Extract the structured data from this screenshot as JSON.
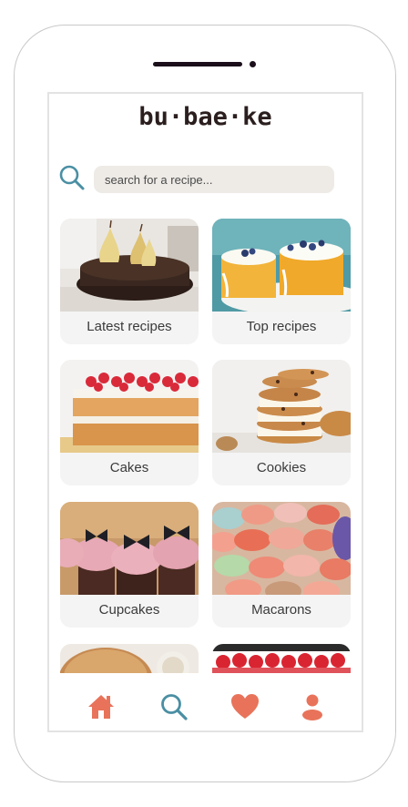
{
  "app": {
    "logo_text": "bu·bae·ke"
  },
  "search": {
    "placeholder": "search for a recipe..."
  },
  "categories": [
    {
      "label": "Latest recipes",
      "image": "chocolate-cake-with-pears"
    },
    {
      "label": "Top recipes",
      "image": "blueberry-cheesecakes"
    },
    {
      "label": "Cakes",
      "image": "raspberry-sponge-cake"
    },
    {
      "label": "Cookies",
      "image": "stacked-cookies"
    },
    {
      "label": "Cupcakes",
      "image": "bow-topped-cupcakes"
    },
    {
      "label": "Macarons",
      "image": "colorful-macarons"
    },
    {
      "label": "",
      "image": "pie-and-drink"
    },
    {
      "label": "",
      "image": "strawberry-tart"
    }
  ],
  "nav": {
    "items": [
      "home-icon",
      "search-icon",
      "heart-icon",
      "user-icon"
    ],
    "active_color": "#e8735a",
    "accent_color": "#4a8fa3"
  }
}
